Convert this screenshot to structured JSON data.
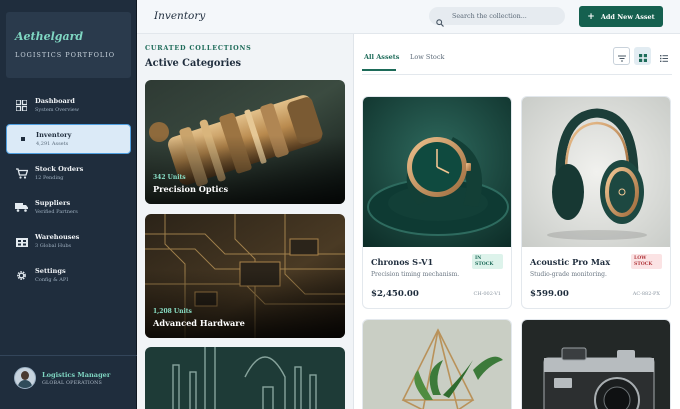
{
  "brand": {
    "name": "Aethelgard",
    "subtitle": "LOGISTICS PORTFOLIO"
  },
  "nav": [
    {
      "label": "Dashboard",
      "sub": "System Overview",
      "icon": "dashboard-icon"
    },
    {
      "label": "Inventory",
      "sub": "4,291 Assets",
      "icon": "inventory-icon",
      "active": true
    },
    {
      "label": "Stock Orders",
      "sub": "12 Pending",
      "icon": "cart-icon"
    },
    {
      "label": "Suppliers",
      "sub": "Verified Partners",
      "icon": "truck-icon"
    },
    {
      "label": "Warehouses",
      "sub": "3 Global Hubs",
      "icon": "warehouse-icon"
    },
    {
      "label": "Settings",
      "sub": "Config & API",
      "icon": "gear-icon"
    }
  ],
  "user": {
    "name": "Logistics Manager",
    "role": "GLOBAL OPERATIONS"
  },
  "header": {
    "title": "Inventory",
    "search_placeholder": "Search the collection...",
    "add_label": "Add New Asset"
  },
  "categories": {
    "eyebrow": "CURATED COLLECTIONS",
    "heading": "Active Categories",
    "items": [
      {
        "units": "342 Units",
        "name": "Precision Optics"
      },
      {
        "units": "1,208 Units",
        "name": "Advanced Hardware"
      }
    ]
  },
  "products": {
    "tabs": [
      "All Assets",
      "Low Stock"
    ],
    "items": [
      {
        "name": "Chronos S-V1",
        "desc": "Precision timing mechanism.",
        "price": "$2,450.00",
        "sku": "CH-002-V1",
        "badge_line1": "IN",
        "badge_line2": "STOCK",
        "status": "in"
      },
      {
        "name": "Acoustic Pro Max",
        "desc": "Studio-grade monitoring.",
        "price": "$599.00",
        "sku": "AC-882-PX",
        "badge_line1": "LOW",
        "badge_line2": "STOCK",
        "status": "low"
      }
    ]
  },
  "colors": {
    "accent": "#15604f",
    "sidebar": "#1f2d3d",
    "brand_text": "#7fd6c2",
    "low_stock": "#b23a3f"
  }
}
